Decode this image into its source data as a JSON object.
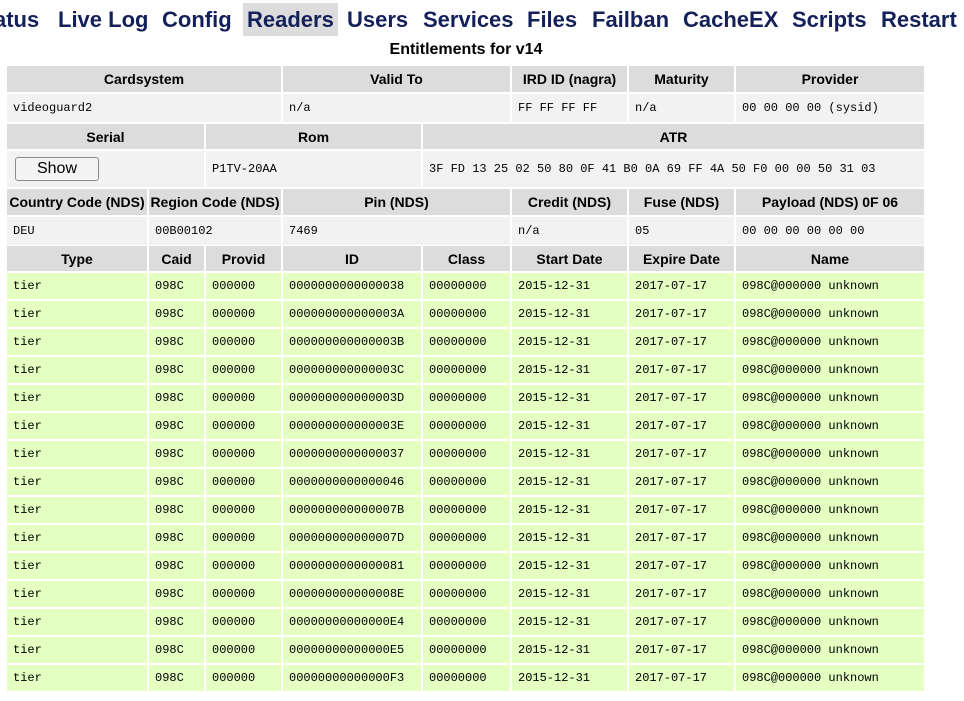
{
  "nav": {
    "items": [
      {
        "label": "Status",
        "name": "nav-status"
      },
      {
        "label": "Live Log",
        "name": "nav-live-log"
      },
      {
        "label": "Config",
        "name": "nav-config"
      },
      {
        "label": "Readers",
        "name": "nav-readers",
        "active": true
      },
      {
        "label": "Users",
        "name": "nav-users"
      },
      {
        "label": "Services",
        "name": "nav-services"
      },
      {
        "label": "Files",
        "name": "nav-files"
      },
      {
        "label": "Failban",
        "name": "nav-failban"
      },
      {
        "label": "CacheEX",
        "name": "nav-cacheex"
      },
      {
        "label": "Scripts",
        "name": "nav-scripts"
      },
      {
        "label": "Restart",
        "name": "nav-restart"
      }
    ]
  },
  "page": {
    "title": "Entitlements for v14"
  },
  "card": {
    "headers": {
      "cardsystem": "Cardsystem",
      "valid_to": "Valid To",
      "ird_id": "IRD ID (nagra)",
      "maturity": "Maturity",
      "provider": "Provider",
      "serial": "Serial",
      "rom": "Rom",
      "atr": "ATR",
      "country_code": "Country Code (NDS)",
      "region_code": "Region Code (NDS)",
      "pin": "Pin (NDS)",
      "credit": "Credit (NDS)",
      "fuse": "Fuse (NDS)",
      "payload": "Payload (NDS) 0F 06"
    },
    "values": {
      "cardsystem": "videoguard2",
      "valid_to": "n/a",
      "ird_id": "FF FF FF FF",
      "maturity": "n/a",
      "provider": "00 00 00 00 (sysid)",
      "serial_button": "Show",
      "rom": "P1TV-20AA",
      "atr": "3F FD 13 25 02 50 80 0F 41 B0 0A 69 FF 4A 50 F0 00 00 50 31 03",
      "country_code": "DEU",
      "region_code": "00B00102",
      "pin": "7469",
      "credit": "n/a",
      "fuse": "05",
      "payload": "00 00 00 00 00 00"
    }
  },
  "entitlements": {
    "columns": [
      "Type",
      "Caid",
      "Provid",
      "ID",
      "Class",
      "Start Date",
      "Expire Date",
      "Name"
    ],
    "rows": [
      [
        "tier",
        "098C",
        "000000",
        "0000000000000038",
        "00000000",
        "2015-12-31",
        "2017-07-17",
        "098C@000000 unknown"
      ],
      [
        "tier",
        "098C",
        "000000",
        "000000000000003A",
        "00000000",
        "2015-12-31",
        "2017-07-17",
        "098C@000000 unknown"
      ],
      [
        "tier",
        "098C",
        "000000",
        "000000000000003B",
        "00000000",
        "2015-12-31",
        "2017-07-17",
        "098C@000000 unknown"
      ],
      [
        "tier",
        "098C",
        "000000",
        "000000000000003C",
        "00000000",
        "2015-12-31",
        "2017-07-17",
        "098C@000000 unknown"
      ],
      [
        "tier",
        "098C",
        "000000",
        "000000000000003D",
        "00000000",
        "2015-12-31",
        "2017-07-17",
        "098C@000000 unknown"
      ],
      [
        "tier",
        "098C",
        "000000",
        "000000000000003E",
        "00000000",
        "2015-12-31",
        "2017-07-17",
        "098C@000000 unknown"
      ],
      [
        "tier",
        "098C",
        "000000",
        "0000000000000037",
        "00000000",
        "2015-12-31",
        "2017-07-17",
        "098C@000000 unknown"
      ],
      [
        "tier",
        "098C",
        "000000",
        "0000000000000046",
        "00000000",
        "2015-12-31",
        "2017-07-17",
        "098C@000000 unknown"
      ],
      [
        "tier",
        "098C",
        "000000",
        "000000000000007B",
        "00000000",
        "2015-12-31",
        "2017-07-17",
        "098C@000000 unknown"
      ],
      [
        "tier",
        "098C",
        "000000",
        "000000000000007D",
        "00000000",
        "2015-12-31",
        "2017-07-17",
        "098C@000000 unknown"
      ],
      [
        "tier",
        "098C",
        "000000",
        "0000000000000081",
        "00000000",
        "2015-12-31",
        "2017-07-17",
        "098C@000000 unknown"
      ],
      [
        "tier",
        "098C",
        "000000",
        "000000000000008E",
        "00000000",
        "2015-12-31",
        "2017-07-17",
        "098C@000000 unknown"
      ],
      [
        "tier",
        "098C",
        "000000",
        "00000000000000E4",
        "00000000",
        "2015-12-31",
        "2017-07-17",
        "098C@000000 unknown"
      ],
      [
        "tier",
        "098C",
        "000000",
        "00000000000000E5",
        "00000000",
        "2015-12-31",
        "2017-07-17",
        "098C@000000 unknown"
      ],
      [
        "tier",
        "098C",
        "000000",
        "00000000000000F3",
        "00000000",
        "2015-12-31",
        "2017-07-17",
        "098C@000000 unknown"
      ]
    ]
  }
}
